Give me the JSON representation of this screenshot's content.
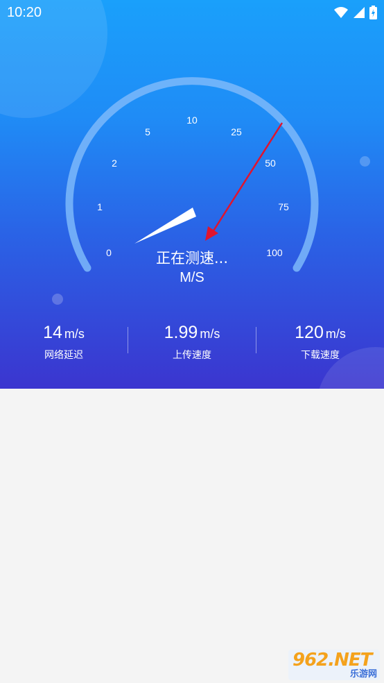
{
  "status_bar": {
    "time": "10:20"
  },
  "gauge": {
    "ticks": [
      "0",
      "1",
      "2",
      "5",
      "10",
      "25",
      "50",
      "75",
      "100"
    ],
    "status": "正在测速...",
    "unit": "M/S",
    "colors": {
      "arc": "#7cb8fa",
      "needle": "#ffffff",
      "annotation_arrow": "#e0142e"
    }
  },
  "stats": [
    {
      "value": "14",
      "unit": "m/s",
      "label": "网络延迟"
    },
    {
      "value": "1.99",
      "unit": "m/s",
      "label": "上传速度"
    },
    {
      "value": "120",
      "unit": "m/s",
      "label": "下载速度"
    }
  ],
  "watermark": {
    "main": "962.NET",
    "sub": "乐游网"
  },
  "colors": {
    "gradient_top": "#1aa0fb",
    "gradient_bottom": "#3b35cf",
    "body_background": "#f4f4f4"
  }
}
